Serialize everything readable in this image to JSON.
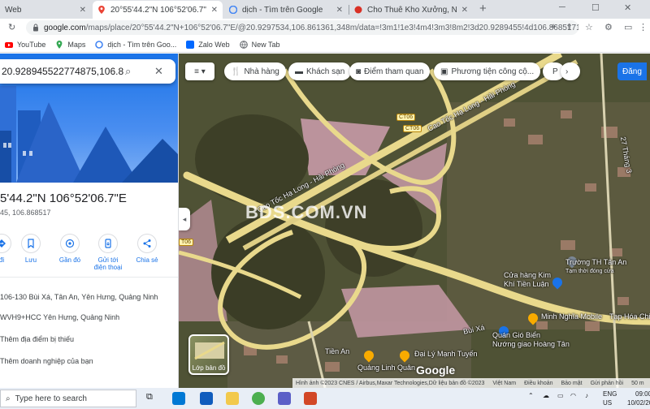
{
  "browser": {
    "tabs": [
      {
        "title": "Web",
        "active": false
      },
      {
        "title": "20°55'44.2\"N 106°52'06.7\"E - Go",
        "active": true
      },
      {
        "title": "dịch - Tìm trên Google",
        "active": false
      },
      {
        "title": "Cho Thuê Kho Xưởng, Nhà Xưởn",
        "active": false
      }
    ],
    "new_tab_label": "+",
    "url_host": "google.com",
    "url_path": "/maps/place/20°55'44.2\"N+106°52'06.7\"E/@20.9297534,106.861361,348m/data=!3m1!1e3!4m4!3m3!8m2!3d20.9289455!4d106.8685171",
    "bookmarks": [
      {
        "label": "YouTube",
        "icon": "youtube-icon"
      },
      {
        "label": "Maps",
        "icon": "maps-icon"
      },
      {
        "label": "dịch - Tìm trên Goo...",
        "icon": "google-icon"
      },
      {
        "label": "Zalo Web",
        "icon": "zalo-icon"
      },
      {
        "label": "New Tab",
        "icon": "globe-icon"
      }
    ]
  },
  "panel": {
    "search_value": "20.928945522774875,106.8685",
    "title": "5'44.2\"N 106°52'06.7\"E",
    "subtitle": "45, 106.868517",
    "actions": [
      {
        "label": "đi",
        "icon": "directions-icon"
      },
      {
        "label": "Lưu",
        "icon": "bookmark-icon"
      },
      {
        "label": "Gần đó",
        "icon": "nearby-icon"
      },
      {
        "label": "Gửi tới điện thoại",
        "icon": "send-to-phone-icon"
      },
      {
        "label": "Chia sẻ",
        "icon": "share-icon"
      }
    ],
    "address": "106-130 Bùi Xá, Tân An, Yên Hưng, Quảng Ninh",
    "plus_code": "WVH9+HCC Yên Hưng, Quảng Ninh",
    "add_place": "Thêm địa điểm bị thiếu",
    "add_business": "Thêm doanh nghiệp của bạn"
  },
  "map": {
    "chips": [
      {
        "label": "Nhà hàng",
        "icon": "restaurant-icon"
      },
      {
        "label": "Khách sạn",
        "icon": "hotel-icon"
      },
      {
        "label": "Điểm tham quan",
        "icon": "camera-icon"
      },
      {
        "label": "Phương tiện công cộ...",
        "icon": "transit-icon"
      },
      {
        "label": "P",
        "icon": "parking-icon"
      }
    ],
    "login_label": "Đăng",
    "road_labels": [
      "Cao Tốc Hạ Long - Hải Phòng",
      "Cao Tốc Hạ Long - Hải Phòng",
      "Bùi Xá",
      "Tiền An",
      "27 Tháng 3"
    ],
    "shields": [
      "CT06",
      "CT06",
      "T06"
    ],
    "watermark": "BDS.COM.VN",
    "pois": [
      {
        "name": "Trường TH Tân An",
        "sub": "Tạm thời đóng cửa"
      },
      {
        "name": "Cửa hàng Kim",
        "sub": "Khí Tiền Luận"
      },
      {
        "name": "Minh Nghĩa Mobile",
        "sub": ""
      },
      {
        "name": "Tạp Hóa Chi",
        "sub": ""
      },
      {
        "name": "Quán Gió Biển",
        "sub": "Nướng giao Hoàng Tân"
      },
      {
        "name": "Đại Lý Mạnh Tuyến",
        "sub": ""
      },
      {
        "name": "Quảng Linh Quân",
        "sub": ""
      }
    ],
    "layer_label": "Lớp bản đồ",
    "logo": "Google",
    "footer": [
      "Hình ảnh ©2023 CNES / Airbus,Maxar Technologies,Dữ liệu bản đồ ©2023",
      "Việt Nam",
      "Điều khoản",
      "Bảo mật",
      "Gửi phản hồi",
      "50 m"
    ]
  },
  "taskbar": {
    "search_placeholder": "Type here to search",
    "lang": "ENG",
    "region": "US",
    "time": "09:00",
    "date": "10/02/2023"
  },
  "colors": {
    "accent": "#1a73e8",
    "road": "#e9d98c",
    "pink_field": "#c79aa7"
  }
}
